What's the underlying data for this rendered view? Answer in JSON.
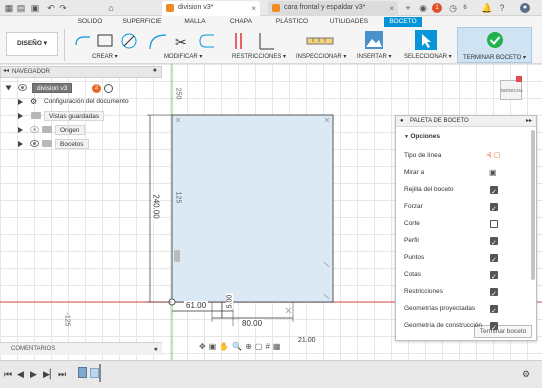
{
  "tabs": [
    {
      "label": "division v3*",
      "active": true
    },
    {
      "label": "cara frontal y espaldar v3*",
      "active": false
    }
  ],
  "tab_counts": {
    "notifications": "1",
    "online": "6"
  },
  "ribbon_tabs": [
    "SOLIDO",
    "SUPERFICIE",
    "MALLA",
    "CHAPA",
    "PLÁSTICO",
    "UTILIDADES",
    "BOCETO"
  ],
  "ribbon": {
    "workspace": "DISEÑO ▾",
    "groups": [
      "CREAR ▾",
      "MODIFICAR ▾",
      "RESTRICCIONES ▾",
      "INSPECCIONAR ▾",
      "INSERTAR ▾",
      "SELECCIONAR ▾",
      "TERMINAR BOCETO ▾"
    ]
  },
  "navigator": {
    "title": "NAVEGADOR",
    "root": "division v3",
    "root_badge": "2",
    "items": [
      "Configuración del documento",
      "Vistas guardadas",
      "Origen",
      "Bocetos"
    ]
  },
  "viewcube": "DERECHA",
  "canvas": {
    "axis_labels": [
      "250",
      "125",
      "-125"
    ],
    "dims": [
      "240.00",
      "61.00",
      "5.00",
      "80.00",
      "21.00"
    ]
  },
  "palette": {
    "title": "PALETA DE BOCETO",
    "section": "Opciones",
    "rows": [
      {
        "label": "Tipo de línea",
        "kind": "linetype"
      },
      {
        "label": "Mirar a",
        "kind": "look"
      },
      {
        "label": "Rejilla del boceto",
        "checked": true
      },
      {
        "label": "Forzar",
        "checked": true
      },
      {
        "label": "Corte",
        "checked": false
      },
      {
        "label": "Perfil",
        "checked": true
      },
      {
        "label": "Puntos",
        "checked": true
      },
      {
        "label": "Cotas",
        "checked": true
      },
      {
        "label": "Restricciones",
        "checked": true
      },
      {
        "label": "Geometrías proyectadas",
        "checked": true
      },
      {
        "label": "Geometría de construcción",
        "checked": true
      }
    ],
    "finish": "Terminar boceto"
  },
  "comments": "COMENTARIOS",
  "colors": {
    "accent": "#0696d7",
    "sketch_fill": "#dbe9f5",
    "finish_green": "#21b24b",
    "axis_red": "#e34b4b",
    "orange": "#f08a24"
  }
}
